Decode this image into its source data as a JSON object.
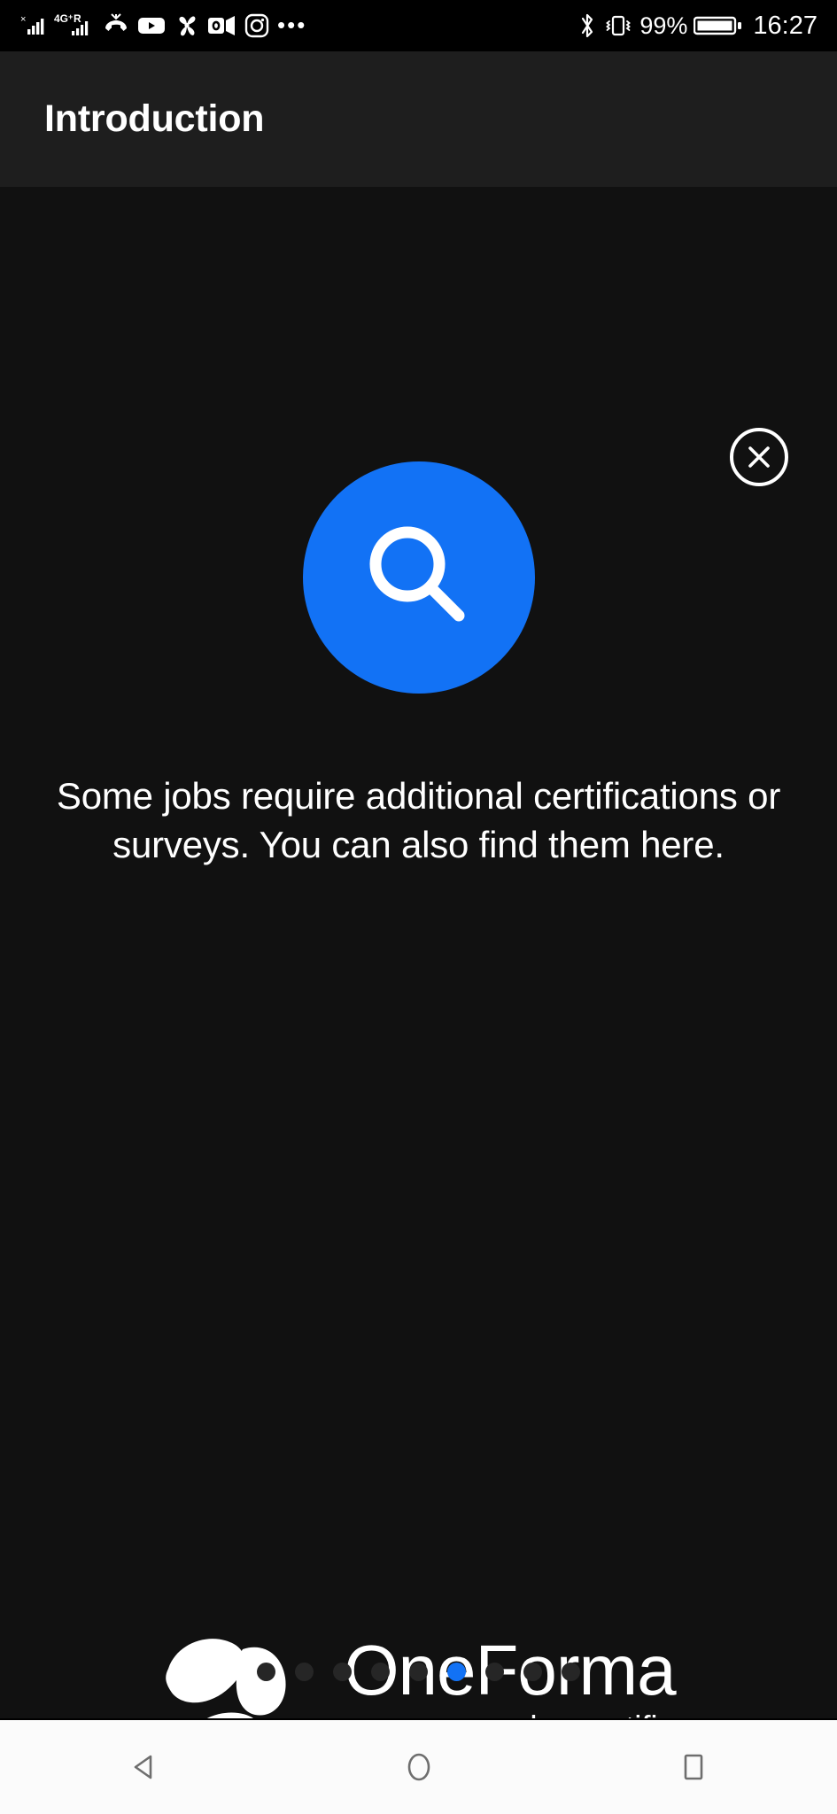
{
  "status_bar": {
    "left_icons": [
      {
        "name": "no-sim-signal-icon",
        "label": "signal-bars-1"
      },
      {
        "name": "network-4g-plus-roaming-icon",
        "label": "4G+R"
      },
      {
        "name": "missed-call-icon",
        "label": "missed call"
      },
      {
        "name": "youtube-icon",
        "label": "YouTube"
      },
      {
        "name": "fan-app-icon",
        "label": "fan"
      },
      {
        "name": "outlook-icon",
        "label": "Outlook"
      },
      {
        "name": "instagram-icon",
        "label": "Instagram"
      },
      {
        "name": "more-notifications-icon",
        "label": "•••"
      }
    ],
    "network_label": "4G+R",
    "bluetooth": "bluetooth-icon",
    "vibrate": "vibrate-icon",
    "battery_percent": "99%",
    "battery_icon": "battery-full-icon",
    "clock": "16:27",
    "overflow_dots": "•••"
  },
  "app_bar": {
    "title": "Introduction"
  },
  "content": {
    "close_label": "close-icon",
    "hero_icon": "search-icon",
    "hero_icon_color": "#1272F5",
    "description": "Some jobs require additional certifications or surveys. You can also find them here."
  },
  "brand": {
    "logo_mark": "oneforma-logo-mark",
    "name": "OneForma",
    "tagline": "by centific"
  },
  "pager": {
    "total": 9,
    "active_index": 5,
    "active_color": "#1272F5",
    "inactive_color": "#262626"
  },
  "nav_bar": {
    "back": "back-triangle-icon",
    "home": "home-circle-icon",
    "recents": "recents-square-icon"
  }
}
